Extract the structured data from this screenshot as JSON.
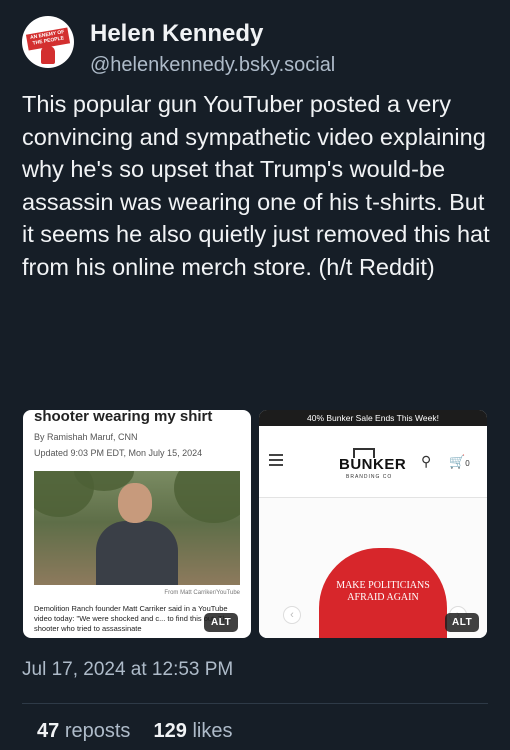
{
  "author": {
    "name": "Helen Kennedy",
    "handle": "@helenkennedy.bsky.social",
    "avatar_text": "AN ENEMY OF THE PEOPLE"
  },
  "post": {
    "text": "This popular gun YouTuber posted a very convincing and sympathetic video explaining why he's so upset that Trump's would-be assassin was wearing one of his t-shirts. But it seems he also quietly just removed this hat from his online merch store. (h/t Reddit)",
    "timestamp": "Jul 17, 2024 at 12:53 PM"
  },
  "images": [
    {
      "headline": "shooter wearing my shirt",
      "byline": "By Ramishah Maruf, CNN",
      "date": "Updated 9:03 PM EDT, Mon July 15, 2024",
      "credit": "From Matt Carriker/YouTube",
      "caption": "Demolition Ranch founder Matt Carriker said in a YouTube video today: \"We were shocked and c... to find this out: The shooter who tried to assassinate",
      "alt_label": "ALT"
    },
    {
      "promo": "40% Bunker Sale Ends This Week!",
      "logo": "BUNKER",
      "logo_sub": "BRANDING CO",
      "cart_count": "0",
      "hat_text": "MAKE POLITICIANS AFRAID AGAIN",
      "alt_label": "ALT"
    }
  ],
  "stats": {
    "reposts_count": "47",
    "reposts_label": "reposts",
    "likes_count": "129",
    "likes_label": "likes"
  }
}
